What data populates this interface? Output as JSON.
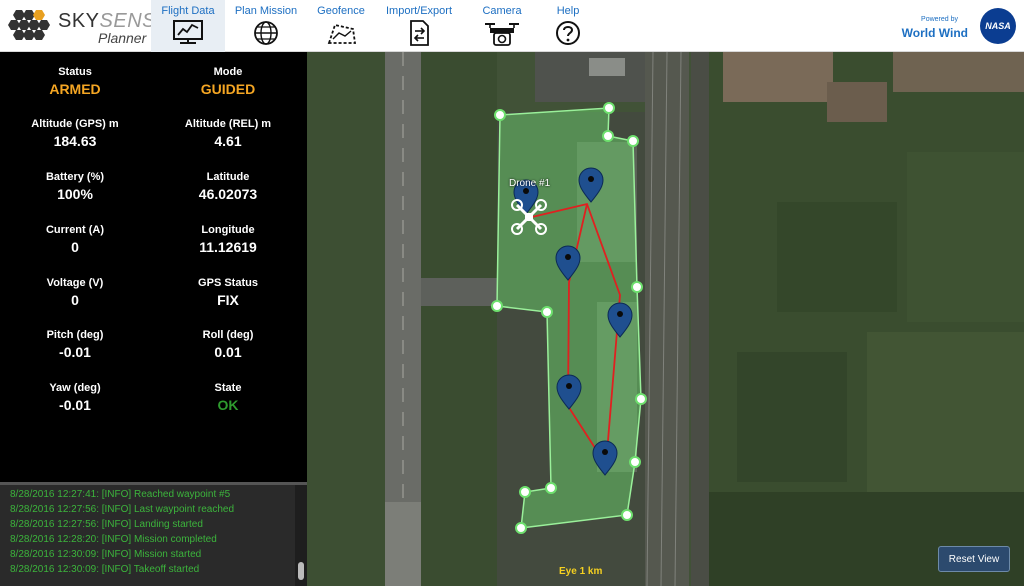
{
  "app": {
    "name_main": "SKY",
    "name_accent": "SENSE",
    "subtitle": "Planner"
  },
  "nav": {
    "tabs": [
      {
        "label": "Flight Data",
        "icon": "monitor-chart-icon",
        "active": true
      },
      {
        "label": "Plan Mission",
        "icon": "globe-icon",
        "active": false
      },
      {
        "label": "Geofence",
        "icon": "map-fence-icon",
        "active": false
      },
      {
        "label": "Import/Export",
        "icon": "file-transfer-icon",
        "active": false
      },
      {
        "label": "Camera",
        "icon": "drone-camera-icon",
        "active": false
      },
      {
        "label": "Help",
        "icon": "help-circle-icon",
        "active": false
      }
    ]
  },
  "branding": {
    "powered_by": "Powered by",
    "world_wind": "World Wind",
    "nasa": "NASA"
  },
  "telemetry": {
    "status": {
      "label": "Status",
      "value": "ARMED"
    },
    "mode": {
      "label": "Mode",
      "value": "GUIDED"
    },
    "alt_gps": {
      "label": "Altitude (GPS) m",
      "value": "184.63"
    },
    "alt_rel": {
      "label": "Altitude (REL) m",
      "value": "4.61"
    },
    "battery": {
      "label": "Battery (%)",
      "value": "100%"
    },
    "latitude": {
      "label": "Latitude",
      "value": "46.02073"
    },
    "current": {
      "label": "Current (A)",
      "value": "0"
    },
    "longitude": {
      "label": "Longitude",
      "value": "11.12619"
    },
    "voltage": {
      "label": "Voltage (V)",
      "value": "0"
    },
    "gps_status": {
      "label": "GPS Status",
      "value": "FIX"
    },
    "pitch": {
      "label": "Pitch (deg)",
      "value": "-0.01"
    },
    "roll": {
      "label": "Roll (deg)",
      "value": "0.01"
    },
    "yaw": {
      "label": "Yaw (deg)",
      "value": "-0.01"
    },
    "state": {
      "label": "State",
      "value": "OK"
    }
  },
  "log": {
    "lines": [
      "8/28/2016 12:27:41: [INFO] Reached waypoint #5",
      "8/28/2016 12:27:56: [INFO] Last waypoint reached",
      "8/28/2016 12:27:56: [INFO] Landing started",
      "8/28/2016 12:28:20: [INFO] Mission completed",
      "8/28/2016 12:30:09: [INFO] Mission started",
      "8/28/2016 12:30:09: [INFO] Takeoff started"
    ]
  },
  "map": {
    "drone_label": "Drone #1",
    "eye_label": "Eye  1 km",
    "reset_label": "Reset View"
  },
  "colors": {
    "accent_blue": "#1d6fc2",
    "armed_orange": "#f5a623",
    "ok_green": "#2e9b2e",
    "log_green": "#3cb43c",
    "geofence": "#6ee06e",
    "route": "#e02020",
    "waypoint": "#1f4f8f"
  }
}
